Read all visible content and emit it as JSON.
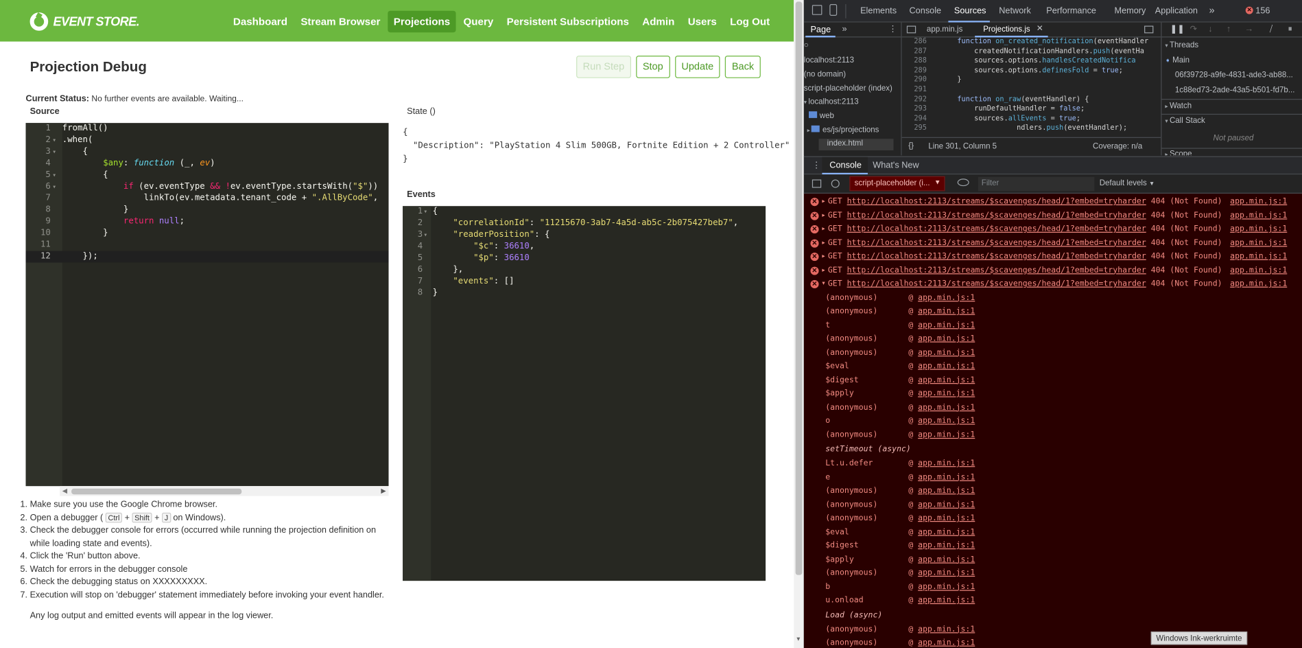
{
  "app": {
    "logo_text": "EVENT STORE.",
    "nav": [
      "Dashboard",
      "Stream Browser",
      "Projections",
      "Query",
      "Persistent Subscriptions",
      "Admin",
      "Users",
      "Log Out"
    ],
    "nav_active": "Projections",
    "page_title": "Projection Debug",
    "buttons": {
      "run_step": "Run Step",
      "stop": "Stop",
      "update": "Update",
      "back": "Back"
    },
    "status_label": "Current Status:",
    "status_text": "No further events are available. Waiting...",
    "source_label": "Source",
    "state_label": "State ()",
    "events_label": "Events",
    "state_json": [
      "{",
      "  \"Description\": \"PlayStation 4 Slim 500GB, Fortnite Edition + 2 Controller\"",
      "}"
    ],
    "instructions": [
      "Make sure you use the Google Chrome browser.",
      "Open a debugger (",
      "Check the debugger console for errors (occurred while running the projection definition on while loading state and events).",
      "Click the 'Run' button above.",
      "Watch for errors in the debugger console",
      "Check the debugging status on XXXXXXXXX.",
      "Execution will stop on 'debugger' statement immediately before invoking your event handler."
    ],
    "instr_keys": [
      "Ctrl",
      "Shift",
      "J"
    ],
    "instr_windows": "on Windows).",
    "log_note": "Any log output and emitted events will appear in the log viewer."
  },
  "devtools": {
    "tabs": [
      "Elements",
      "Console",
      "Sources",
      "Network",
      "Performance",
      "Memory",
      "Application"
    ],
    "tab_active": "Sources",
    "more": "»",
    "error_count": "156",
    "nav_tabs": {
      "page": "Page",
      "more": "»"
    },
    "tree": [
      "localhost:2113",
      "(no domain)",
      "script-placeholder (index)",
      "localhost:2113",
      "web",
      "es/js/projections",
      "index.html"
    ],
    "file_tabs": [
      "app.min.js",
      "Projections.js"
    ],
    "file_active": "Projections.js",
    "src_lines": [
      "286",
      "287",
      "288",
      "289",
      "290",
      "291",
      "292",
      "293",
      "294",
      "295"
    ],
    "status_pos": "Line 301, Column 5",
    "coverage": "Coverage: n/a",
    "threads_label": "Threads",
    "threads": [
      "Main",
      "06f39728-a9fe-4831-ade3-ab88...",
      "1c88ed73-2ade-43a5-b501-fd7b..."
    ],
    "watch": "Watch",
    "callstack": "Call Stack",
    "not_paused": "Not paused",
    "scope": "Scope",
    "drawer_tabs": [
      "Console",
      "What's New"
    ],
    "context": "script-placeholder (i...",
    "filter_placeholder": "Filter",
    "levels": "Default levels",
    "error_rows": [
      {
        "method": "GET",
        "url": "http://localhost:2113/streams/$scavenges/head/1?embed=tryharder",
        "status": "404 (Not Found)",
        "src": "app.min.js:1"
      },
      {
        "method": "GET",
        "url": "http://localhost:2113/streams/$scavenges/head/1?embed=tryharder",
        "status": "404 (Not Found)",
        "src": "app.min.js:1"
      },
      {
        "method": "GET",
        "url": "http://localhost:2113/streams/$scavenges/head/1?embed=tryharder",
        "status": "404 (Not Found)",
        "src": "app.min.js:1"
      },
      {
        "method": "GET",
        "url": "http://localhost:2113/streams/$scavenges/head/1?embed=tryharder",
        "status": "404 (Not Found)",
        "src": "app.min.js:1"
      },
      {
        "method": "GET",
        "url": "http://localhost:2113/streams/$scavenges/head/1?embed=tryharder",
        "status": "404 (Not Found)",
        "src": "app.min.js:1"
      },
      {
        "method": "GET",
        "url": "http://localhost:2113/streams/$scavenges/head/1?embed=tryharder",
        "status": "404 (Not Found)",
        "src": "app.min.js:1"
      },
      {
        "method": "GET",
        "url": "http://localhost:2113/streams/$scavenges/head/1?embed=tryharder",
        "status": "404 (Not Found)",
        "src": "app.min.js:1"
      }
    ],
    "stack": [
      {
        "fn": "(anonymous)",
        "at": "app.min.js:1"
      },
      {
        "fn": "(anonymous)",
        "at": "app.min.js:1"
      },
      {
        "fn": "t",
        "at": "app.min.js:1"
      },
      {
        "fn": "(anonymous)",
        "at": "app.min.js:1"
      },
      {
        "fn": "(anonymous)",
        "at": "app.min.js:1"
      },
      {
        "fn": "$eval",
        "at": "app.min.js:1"
      },
      {
        "fn": "$digest",
        "at": "app.min.js:1"
      },
      {
        "fn": "$apply",
        "at": "app.min.js:1"
      },
      {
        "fn": "(anonymous)",
        "at": "app.min.js:1"
      },
      {
        "fn": "o",
        "at": "app.min.js:1"
      },
      {
        "fn": "(anonymous)",
        "at": "app.min.js:1"
      },
      {
        "fn": "setTimeout (async)",
        "at": ""
      },
      {
        "fn": "Lt.u.defer",
        "at": "app.min.js:1"
      },
      {
        "fn": "e",
        "at": "app.min.js:1"
      },
      {
        "fn": "(anonymous)",
        "at": "app.min.js:1"
      },
      {
        "fn": "(anonymous)",
        "at": "app.min.js:1"
      },
      {
        "fn": "(anonymous)",
        "at": "app.min.js:1"
      },
      {
        "fn": "$eval",
        "at": "app.min.js:1"
      },
      {
        "fn": "$digest",
        "at": "app.min.js:1"
      },
      {
        "fn": "$apply",
        "at": "app.min.js:1"
      },
      {
        "fn": "(anonymous)",
        "at": "app.min.js:1"
      },
      {
        "fn": "b",
        "at": "app.min.js:1"
      },
      {
        "fn": "u.onload",
        "at": "app.min.js:1"
      },
      {
        "fn": "Load (async)",
        "at": ""
      },
      {
        "fn": "(anonymous)",
        "at": "app.min.js:1"
      },
      {
        "fn": "(anonymous)",
        "at": "app.min.js:1"
      }
    ],
    "at_sign": "@",
    "tooltip": "Windows Ink-werkruimte"
  }
}
